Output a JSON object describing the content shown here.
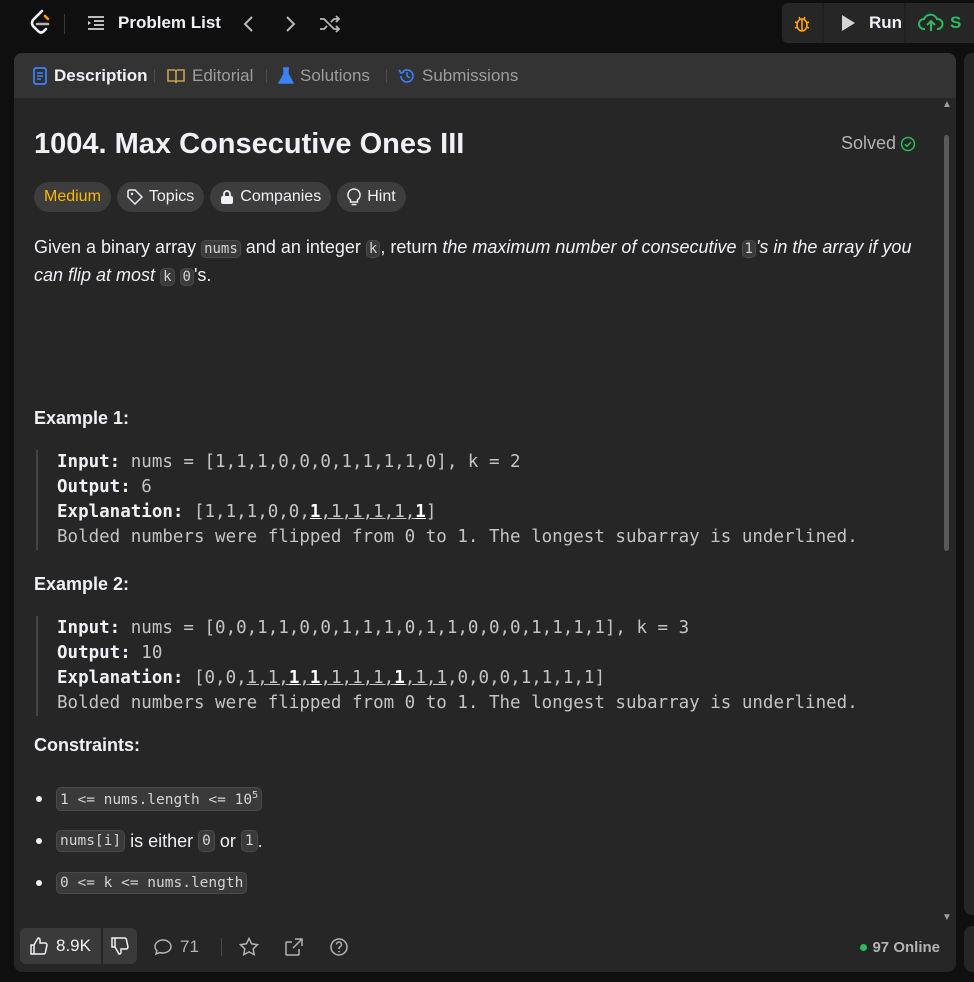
{
  "topbar": {
    "problem_list_label": "Problem List",
    "run_label": "Run",
    "submit_label": "S"
  },
  "tabs": [
    {
      "label": "Description",
      "active": true
    },
    {
      "label": "Editorial",
      "active": false
    },
    {
      "label": "Solutions",
      "active": false
    },
    {
      "label": "Submissions",
      "active": false
    }
  ],
  "problem": {
    "title": "1004. Max Consecutive Ones III",
    "status": "Solved",
    "difficulty": "Medium",
    "tags": {
      "topics": "Topics",
      "companies": "Companies",
      "hint": "Hint"
    },
    "description": {
      "given": "Given a binary array ",
      "nums": "nums",
      "and_int": " and an integer ",
      "k": "k",
      "return": ", return ",
      "em1": "the maximum number of consecutive ",
      "one": "1",
      "em2": "'s in the array if you can flip at most ",
      "zero": "0",
      "end": "'s."
    }
  },
  "examples": [
    {
      "title": "Example 1:",
      "input_label": "Input:",
      "input": " nums = [1,1,1,0,0,0,1,1,1,1,0], k = 2",
      "output_label": "Output:",
      "output": " 6",
      "explanation_label": "Explanation:",
      "explanation_array": "[1,1,1,0,0,1,1,1,1,1,1]",
      "note": "Bolded numbers were flipped from 0 to 1. The longest subarray is underlined."
    },
    {
      "title": "Example 2:",
      "input_label": "Input:",
      "input": " nums = [0,0,1,1,0,0,1,1,1,0,1,1,0,0,0,1,1,1,1], k = 3",
      "output_label": "Output:",
      "output": " 10",
      "explanation_label": "Explanation:",
      "explanation_array": "[0,0,1,1,1,1,1,1,1,1,1,1,0,0,0,1,1,1,1]",
      "note": "Bolded numbers were flipped from 0 to 1. The longest subarray is underlined."
    }
  ],
  "constraints": {
    "title": "Constraints:",
    "c1_code": "1 <= nums.length <= 10",
    "c1_sup": "5",
    "c2_code": "nums[i]",
    "c2_text1": " is either ",
    "c2_zero": "0",
    "c2_or": " or ",
    "c2_one": "1",
    "c2_end": ".",
    "c3_code": "0 <= k <= nums.length"
  },
  "footer": {
    "likes": "8.9K",
    "comments": "71",
    "online": "97 Online"
  },
  "colors": {
    "medium": "#ffb800",
    "online_dot": "#2cbb5d",
    "submit_green": "#2cbb5d",
    "description_blue": "#3b82f6",
    "editorial_gold": "#c8a24a",
    "solutions_blue": "#3b82f6"
  }
}
